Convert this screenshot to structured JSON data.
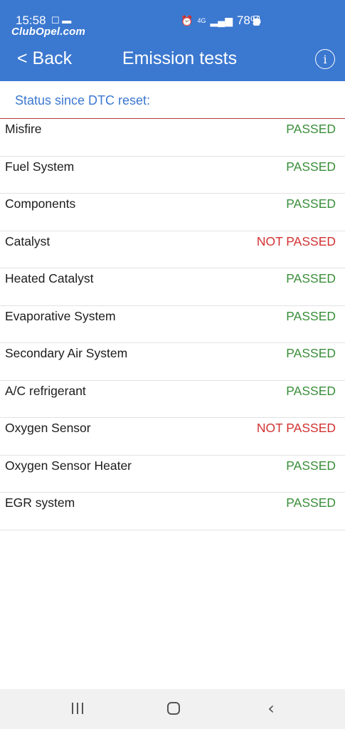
{
  "status_bar": {
    "time": "15:58",
    "left_icons": "☐ ▬",
    "watermark": "ClubOpel.com",
    "alarm_icon": "alarm-icon",
    "network": "4G",
    "battery": "78%"
  },
  "appbar": {
    "back_label": "< Back",
    "title": "Emission tests",
    "info_icon": "info-icon"
  },
  "section_label": "Status since DTC reset:",
  "colors": {
    "accent": "#3b78d0",
    "passed": "#3a8e3a",
    "not_passed": "#d23232"
  },
  "tests": [
    {
      "name": "Misfire",
      "status": "PASSED"
    },
    {
      "name": "Fuel System",
      "status": "PASSED"
    },
    {
      "name": "Components",
      "status": "PASSED"
    },
    {
      "name": "Catalyst",
      "status": "NOT PASSED"
    },
    {
      "name": "Heated Catalyst",
      "status": "PASSED"
    },
    {
      "name": "Evaporative System",
      "status": "PASSED"
    },
    {
      "name": "Secondary Air System",
      "status": "PASSED"
    },
    {
      "name": "A/C refrigerant",
      "status": "PASSED"
    },
    {
      "name": "Oxygen Sensor",
      "status": "NOT PASSED"
    },
    {
      "name": "Oxygen Sensor Heater",
      "status": "PASSED"
    },
    {
      "name": "EGR system",
      "status": "PASSED"
    }
  ],
  "nav_bar": {
    "recents_icon": "recents-icon",
    "home_icon": "home-icon",
    "back_icon": "back-icon"
  }
}
